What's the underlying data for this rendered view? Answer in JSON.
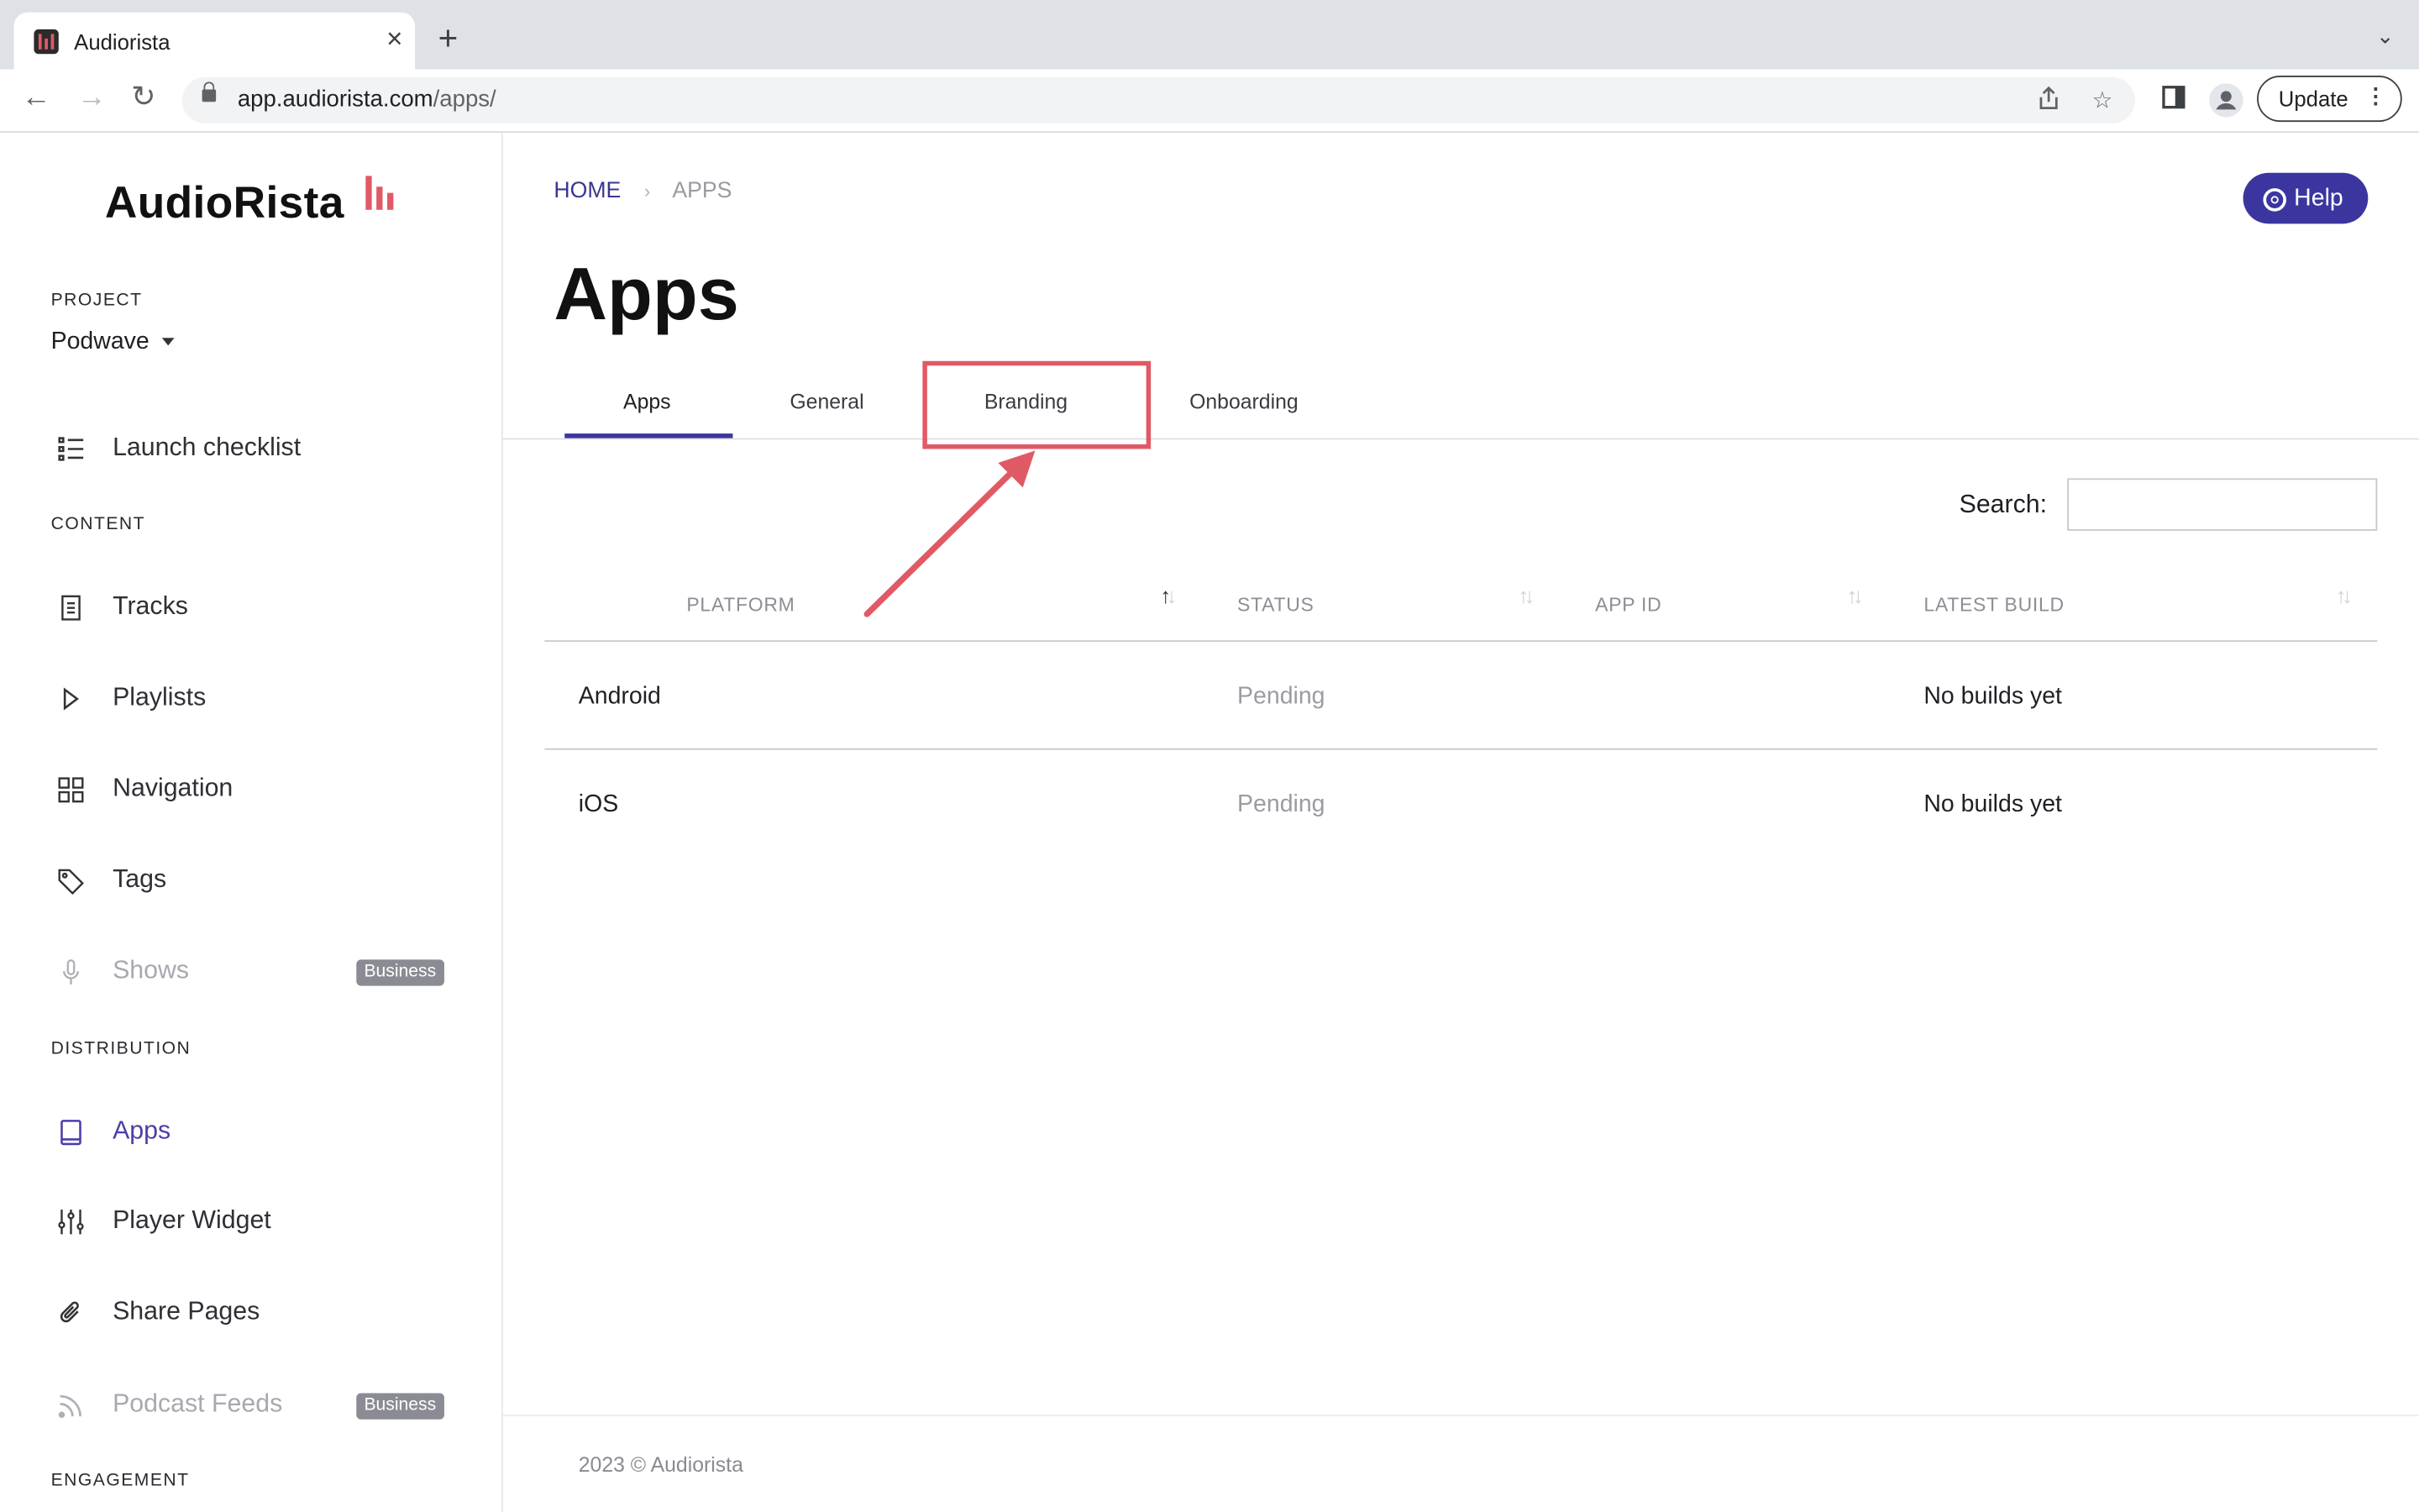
{
  "browser": {
    "tab_title": "Audiorista",
    "url_host": "app.audiorista.com",
    "url_path": "/apps/",
    "update_label": "Update"
  },
  "sidebar": {
    "logo": "AudioRista",
    "project_label": "PROJECT",
    "project_name": "Podwave",
    "launch_checklist": "Launch checklist",
    "content_label": "CONTENT",
    "content_items": [
      {
        "label": "Tracks",
        "icon": "document-icon"
      },
      {
        "label": "Playlists",
        "icon": "play-icon"
      },
      {
        "label": "Navigation",
        "icon": "grid-icon"
      },
      {
        "label": "Tags",
        "icon": "tag-icon"
      },
      {
        "label": "Shows",
        "icon": "microphone-icon",
        "badge": "Business"
      }
    ],
    "distribution_label": "DISTRIBUTION",
    "distribution_items": [
      {
        "label": "Apps",
        "icon": "tablet-icon"
      },
      {
        "label": "Player Widget",
        "icon": "sliders-icon"
      },
      {
        "label": "Share Pages",
        "icon": "paperclip-icon"
      },
      {
        "label": "Podcast Feeds",
        "icon": "rss-icon",
        "badge": "Business"
      }
    ],
    "engagement_label": "ENGAGEMENT"
  },
  "main": {
    "breadcrumb": {
      "home": "HOME",
      "separator": "›",
      "current": "APPS"
    },
    "help_label": "Help",
    "title": "Apps",
    "tabs": [
      "Apps",
      "General",
      "Branding",
      "Onboarding"
    ],
    "search_label": "Search:",
    "search_value": "",
    "table": {
      "columns": [
        "PLATFORM",
        "STATUS",
        "APP ID",
        "LATEST BUILD"
      ],
      "rows": [
        {
          "platform": "Android",
          "status": "Pending",
          "app_id": "",
          "latest_build": "No builds yet"
        },
        {
          "platform": "iOS",
          "status": "Pending",
          "app_id": "",
          "latest_build": "No builds yet"
        }
      ]
    },
    "footer": "2023 © Audiorista"
  },
  "colors": {
    "accent": "#3b369f",
    "highlight": "#e05a66",
    "badge": "#8b8c93"
  }
}
